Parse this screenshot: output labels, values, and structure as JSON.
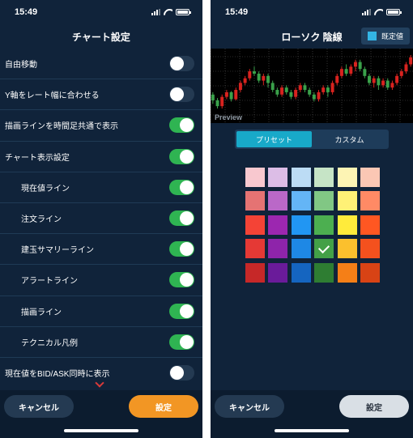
{
  "left": {
    "time": "15:49",
    "title": "チャート設定",
    "settings": [
      {
        "label": "自由移動",
        "on": false,
        "indent": false
      },
      {
        "label": "Y軸をレート幅に合わせる",
        "on": false,
        "indent": false
      },
      {
        "label": "描画ラインを時間足共通で表示",
        "on": true,
        "indent": false
      },
      {
        "label": "チャート表示設定",
        "on": true,
        "indent": false
      },
      {
        "label": "現在値ライン",
        "on": true,
        "indent": true
      },
      {
        "label": "注文ライン",
        "on": true,
        "indent": true
      },
      {
        "label": "建玉サマリーライン",
        "on": true,
        "indent": true
      },
      {
        "label": "アラートライン",
        "on": true,
        "indent": true
      },
      {
        "label": "描画ライン",
        "on": true,
        "indent": true
      },
      {
        "label": "テクニカル凡例",
        "on": true,
        "indent": true
      },
      {
        "label": "現在値をBID/ASK同時に表示",
        "on": false,
        "indent": false
      }
    ],
    "cancel_label": "キャンセル",
    "set_label": "設定"
  },
  "right": {
    "time": "15:49",
    "title": "ローソク 陰線",
    "default_label": "既定値",
    "default_color": "#33b5e5",
    "preview_label": "Preview",
    "tabs": [
      {
        "label": "プリセット",
        "active": true
      },
      {
        "label": "カスタム",
        "active": false
      }
    ],
    "palette": [
      [
        "#f8c8cf",
        "#dcbde6",
        "#bcdcf5",
        "#c6e4c6",
        "#fdf4b4",
        "#fbc7b4"
      ],
      [
        "#e57373",
        "#ba68c8",
        "#64b5f6",
        "#81c784",
        "#fff176",
        "#ff8a65"
      ],
      [
        "#f44336",
        "#9c27b0",
        "#2196f3",
        "#4caf50",
        "#ffeb3b",
        "#ff5722"
      ],
      [
        "#e53935",
        "#8e24aa",
        "#1e88e5",
        "#43a047",
        "#fbc02d",
        "#f4511e"
      ],
      [
        "#c62828",
        "#6a1b9a",
        "#1565c0",
        "#2e7d32",
        "#f57f17",
        "#d84315"
      ]
    ],
    "selected": {
      "row": 3,
      "col": 3
    },
    "cancel_label": "キャンセル",
    "set_label": "設定"
  },
  "colors": {
    "background": "#10233a",
    "toggle_on": "#2fb452",
    "accent_orange": "#f29624",
    "accent_cyan": "#18a9c9",
    "candle_up": "#d8231f",
    "candle_down": "#3aa14a"
  },
  "candles": [
    {
      "o": 60,
      "c": 55,
      "h": 62,
      "l": 52
    },
    {
      "o": 55,
      "c": 50,
      "h": 57,
      "l": 48
    },
    {
      "o": 50,
      "c": 58,
      "h": 60,
      "l": 48
    },
    {
      "o": 58,
      "c": 62,
      "h": 64,
      "l": 56
    },
    {
      "o": 62,
      "c": 56,
      "h": 63,
      "l": 54
    },
    {
      "o": 56,
      "c": 64,
      "h": 66,
      "l": 55
    },
    {
      "o": 64,
      "c": 70,
      "h": 72,
      "l": 62
    },
    {
      "o": 70,
      "c": 74,
      "h": 76,
      "l": 68
    },
    {
      "o": 74,
      "c": 80,
      "h": 82,
      "l": 72
    },
    {
      "o": 80,
      "c": 78,
      "h": 84,
      "l": 76
    },
    {
      "o": 78,
      "c": 72,
      "h": 80,
      "l": 70
    },
    {
      "o": 72,
      "c": 76,
      "h": 78,
      "l": 68
    },
    {
      "o": 76,
      "c": 70,
      "h": 78,
      "l": 66
    },
    {
      "o": 70,
      "c": 64,
      "h": 72,
      "l": 62
    },
    {
      "o": 64,
      "c": 60,
      "h": 66,
      "l": 58
    },
    {
      "o": 60,
      "c": 66,
      "h": 68,
      "l": 58
    },
    {
      "o": 66,
      "c": 62,
      "h": 68,
      "l": 60
    },
    {
      "o": 62,
      "c": 58,
      "h": 64,
      "l": 56
    },
    {
      "o": 58,
      "c": 64,
      "h": 66,
      "l": 56
    },
    {
      "o": 64,
      "c": 68,
      "h": 70,
      "l": 62
    },
    {
      "o": 68,
      "c": 64,
      "h": 70,
      "l": 62
    },
    {
      "o": 64,
      "c": 60,
      "h": 66,
      "l": 58
    },
    {
      "o": 60,
      "c": 56,
      "h": 62,
      "l": 54
    },
    {
      "o": 56,
      "c": 62,
      "h": 64,
      "l": 54
    },
    {
      "o": 62,
      "c": 66,
      "h": 68,
      "l": 60
    },
    {
      "o": 66,
      "c": 62,
      "h": 68,
      "l": 58
    },
    {
      "o": 62,
      "c": 70,
      "h": 72,
      "l": 60
    },
    {
      "o": 70,
      "c": 76,
      "h": 78,
      "l": 68
    },
    {
      "o": 76,
      "c": 82,
      "h": 84,
      "l": 74
    },
    {
      "o": 82,
      "c": 78,
      "h": 86,
      "l": 76
    },
    {
      "o": 78,
      "c": 84,
      "h": 86,
      "l": 76
    },
    {
      "o": 84,
      "c": 88,
      "h": 90,
      "l": 80
    },
    {
      "o": 88,
      "c": 82,
      "h": 90,
      "l": 80
    },
    {
      "o": 82,
      "c": 76,
      "h": 84,
      "l": 74
    },
    {
      "o": 76,
      "c": 70,
      "h": 78,
      "l": 68
    },
    {
      "o": 70,
      "c": 74,
      "h": 76,
      "l": 66
    },
    {
      "o": 74,
      "c": 68,
      "h": 76,
      "l": 64
    },
    {
      "o": 68,
      "c": 72,
      "h": 74,
      "l": 66
    },
    {
      "o": 72,
      "c": 66,
      "h": 74,
      "l": 64
    },
    {
      "o": 66,
      "c": 70,
      "h": 72,
      "l": 64
    },
    {
      "o": 70,
      "c": 76,
      "h": 78,
      "l": 68
    },
    {
      "o": 76,
      "c": 80,
      "h": 82,
      "l": 74
    },
    {
      "o": 80,
      "c": 86,
      "h": 88,
      "l": 78
    },
    {
      "o": 86,
      "c": 92,
      "h": 94,
      "l": 84
    }
  ]
}
